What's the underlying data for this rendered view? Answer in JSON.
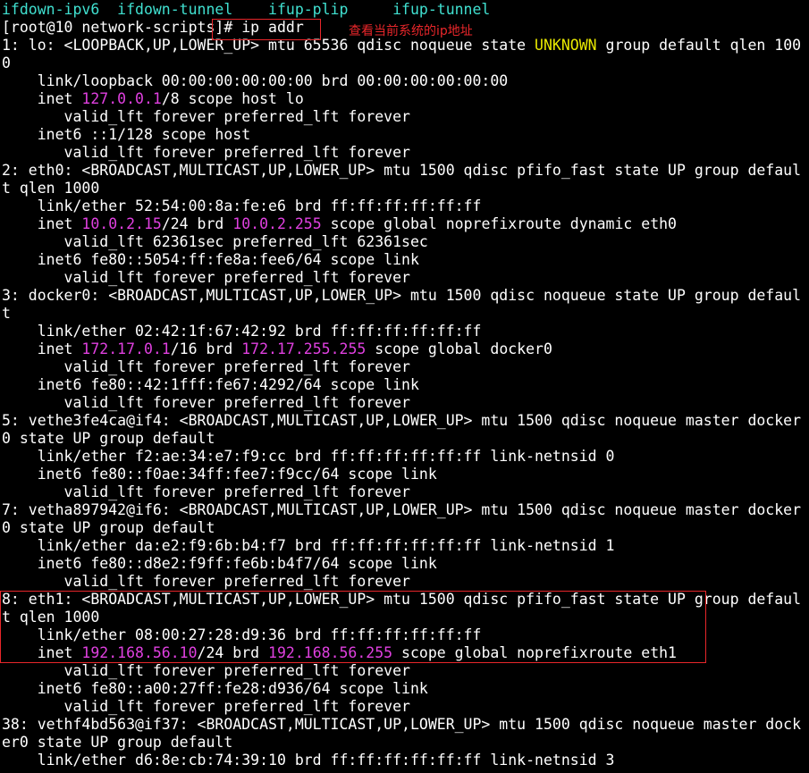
{
  "colors": {
    "background": "#000000",
    "text": "#ffffff",
    "cyan": "#40e0d0",
    "magenta": "#e040e0",
    "yellow": "#e8e800",
    "annotation_red": "#e8262a"
  },
  "annotation": {
    "note": "查看当前系统的ip地址"
  },
  "terminal": {
    "lines": [
      [
        {
          "t": "ifdown-ipv6  ifdown-tunnel    ifup-plip     ifup-tunnel",
          "c": "cyan"
        }
      ],
      [
        {
          "t": "[root@10 network-scripts]# ip addr"
        }
      ],
      [
        {
          "t": "1: lo: <LOOPBACK,UP,LOWER_UP> mtu 65536 qdisc noqueue state "
        },
        {
          "t": "UNKNOWN",
          "c": "yellow"
        },
        {
          "t": " group default qlen 100"
        }
      ],
      [
        {
          "t": "0"
        }
      ],
      [
        {
          "t": "    link/loopback 00:00:00:00:00:00 brd 00:00:00:00:00:00"
        }
      ],
      [
        {
          "t": "    inet "
        },
        {
          "t": "127.0.0.1",
          "c": "magenta"
        },
        {
          "t": "/8 scope host lo"
        }
      ],
      [
        {
          "t": "       valid_lft forever preferred_lft forever"
        }
      ],
      [
        {
          "t": "    inet6 ::1/128 scope host"
        }
      ],
      [
        {
          "t": "       valid_lft forever preferred_lft forever"
        }
      ],
      [
        {
          "t": "2: eth0: <BROADCAST,MULTICAST,UP,LOWER_UP> mtu 1500 qdisc pfifo_fast state UP group defaul"
        }
      ],
      [
        {
          "t": "t qlen 1000"
        }
      ],
      [
        {
          "t": "    link/ether 52:54:00:8a:fe:e6 brd ff:ff:ff:ff:ff:ff"
        }
      ],
      [
        {
          "t": "    inet "
        },
        {
          "t": "10.0.2.15",
          "c": "magenta"
        },
        {
          "t": "/24 brd "
        },
        {
          "t": "10.0.2.255",
          "c": "magenta"
        },
        {
          "t": " scope global noprefixroute dynamic eth0"
        }
      ],
      [
        {
          "t": "       valid_lft 62361sec preferred_lft 62361sec"
        }
      ],
      [
        {
          "t": "    inet6 fe80::5054:ff:fe8a:fee6/64 scope link"
        }
      ],
      [
        {
          "t": "       valid_lft forever preferred_lft forever"
        }
      ],
      [
        {
          "t": "3: docker0: <BROADCAST,MULTICAST,UP,LOWER_UP> mtu 1500 qdisc noqueue state UP group defaul"
        }
      ],
      [
        {
          "t": "t"
        }
      ],
      [
        {
          "t": "    link/ether 02:42:1f:67:42:92 brd ff:ff:ff:ff:ff:ff"
        }
      ],
      [
        {
          "t": "    inet "
        },
        {
          "t": "172.17.0.1",
          "c": "magenta"
        },
        {
          "t": "/16 brd "
        },
        {
          "t": "172.17.255.255",
          "c": "magenta"
        },
        {
          "t": " scope global docker0"
        }
      ],
      [
        {
          "t": "       valid_lft forever preferred_lft forever"
        }
      ],
      [
        {
          "t": "    inet6 fe80::42:1fff:fe67:4292/64 scope link"
        }
      ],
      [
        {
          "t": "       valid_lft forever preferred_lft forever"
        }
      ],
      [
        {
          "t": "5: vethe3fe4ca@if4: <BROADCAST,MULTICAST,UP,LOWER_UP> mtu 1500 qdisc noqueue master docker"
        }
      ],
      [
        {
          "t": "0 state UP group default"
        }
      ],
      [
        {
          "t": "    link/ether f2:ae:34:e7:f9:cc brd ff:ff:ff:ff:ff:ff link-netnsid 0"
        }
      ],
      [
        {
          "t": "    inet6 fe80::f0ae:34ff:fee7:f9cc/64 scope link"
        }
      ],
      [
        {
          "t": "       valid_lft forever preferred_lft forever"
        }
      ],
      [
        {
          "t": "7: vetha897942@if6: <BROADCAST,MULTICAST,UP,LOWER_UP> mtu 1500 qdisc noqueue master docker"
        }
      ],
      [
        {
          "t": "0 state UP group default"
        }
      ],
      [
        {
          "t": "    link/ether da:e2:f9:6b:b4:f7 brd ff:ff:ff:ff:ff:ff link-netnsid 1"
        }
      ],
      [
        {
          "t": "    inet6 fe80::d8e2:f9ff:fe6b:b4f7/64 scope link"
        }
      ],
      [
        {
          "t": "       valid_lft forever preferred_lft forever"
        }
      ],
      [
        {
          "t": "8: eth1: <BROADCAST,MULTICAST,UP,LOWER_UP> mtu 1500 qdisc pfifo_fast state UP group defaul"
        }
      ],
      [
        {
          "t": "t qlen 1000"
        }
      ],
      [
        {
          "t": "    link/ether 08:00:27:28:d9:36 brd ff:ff:ff:ff:ff:ff"
        }
      ],
      [
        {
          "t": "    inet "
        },
        {
          "t": "192.168.56.10",
          "c": "magenta"
        },
        {
          "t": "/24 brd "
        },
        {
          "t": "192.168.56.255",
          "c": "magenta"
        },
        {
          "t": " scope global noprefixroute eth1"
        }
      ],
      [
        {
          "t": "       valid_lft forever preferred_lft forever"
        }
      ],
      [
        {
          "t": "    inet6 fe80::a00:27ff:fe28:d936/64 scope link"
        }
      ],
      [
        {
          "t": "       valid_lft forever preferred_lft forever"
        }
      ],
      [
        {
          "t": "38: vethf4bd563@if37: <BROADCAST,MULTICAST,UP,LOWER_UP> mtu 1500 qdisc noqueue master dock"
        }
      ],
      [
        {
          "t": "er0 state UP group default"
        }
      ],
      [
        {
          "t": "    link/ether d6:8e:cb:74:39:10 brd ff:ff:ff:ff:ff:ff link-netnsid 3"
        }
      ]
    ]
  }
}
